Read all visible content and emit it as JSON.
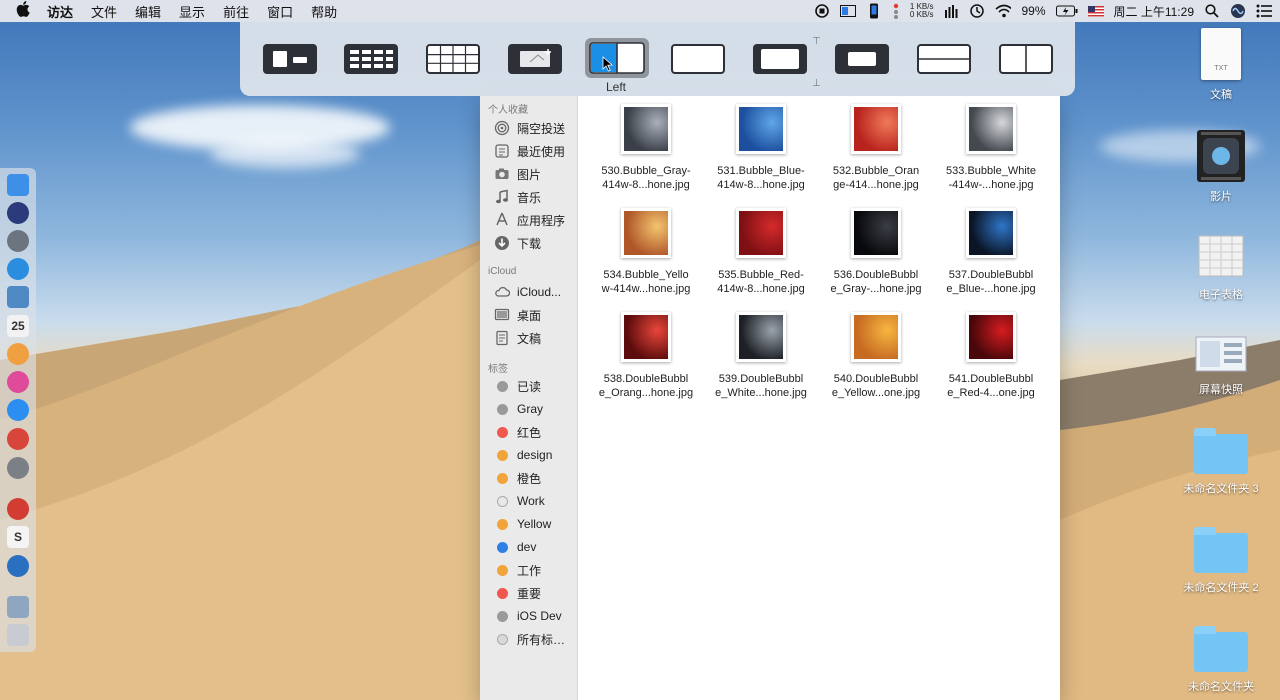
{
  "menubar": {
    "apple_icon": "apple-logo-icon",
    "items": [
      "访达",
      "文件",
      "编辑",
      "显示",
      "前往",
      "窗口",
      "帮助"
    ],
    "net_up": "1 KB/s",
    "net_down": "0 KB/s",
    "battery": "99%",
    "clock": "周二 上午11:29"
  },
  "layout_panel": {
    "selected_label": "Left",
    "options": [
      "fullscreen-plus",
      "grid-2x4",
      "grid-3x4",
      "centered-plus",
      "left-half",
      "wide-center",
      "center",
      "small-center",
      "top-bottom",
      "two-columns"
    ]
  },
  "finder": {
    "sections": {
      "favorites": "个人收藏",
      "icloud": "iCloud",
      "tags": "标签"
    },
    "favorites": [
      {
        "label": "隔空投送",
        "icon": "airdrop-icon"
      },
      {
        "label": "最近使用",
        "icon": "recents-icon"
      },
      {
        "label": "图片",
        "icon": "camera-icon"
      },
      {
        "label": "音乐",
        "icon": "music-icon"
      },
      {
        "label": "应用程序",
        "icon": "applications-icon"
      },
      {
        "label": "下载",
        "icon": "download-icon"
      }
    ],
    "icloud": [
      {
        "label": "iCloud...",
        "icon": "cloud-icon"
      },
      {
        "label": "桌面",
        "icon": "desktop-icon"
      },
      {
        "label": "文稿",
        "icon": "documents-icon"
      }
    ],
    "tags": [
      {
        "label": "已读",
        "color": "#9a9a9a"
      },
      {
        "label": "Gray",
        "color": "#9a9a9a"
      },
      {
        "label": "红色",
        "color": "#f0574d"
      },
      {
        "label": "design",
        "color": "#f2a33a"
      },
      {
        "label": "橙色",
        "color": "#f2a33a"
      },
      {
        "label": "Work",
        "color": "#e8e8e8"
      },
      {
        "label": "Yellow",
        "color": "#f2a33a"
      },
      {
        "label": "dev",
        "color": "#2f7fe6"
      },
      {
        "label": "工作",
        "color": "#f2a33a"
      },
      {
        "label": "重要",
        "color": "#f0574d"
      },
      {
        "label": "iOS Dev",
        "color": "#9a9a9a"
      },
      {
        "label": "所有标…",
        "color": "#d9d9d9"
      }
    ],
    "files": [
      {
        "line1": "530.Bubble_Gray-",
        "line2": "414w-8...hone.jpg",
        "c1": "#3a3f48",
        "c2": "#a9b0ba"
      },
      {
        "line1": "531.Bubble_Blue-",
        "line2": "414w-8...hone.jpg",
        "c1": "#1c4f9e",
        "c2": "#5fa6e8"
      },
      {
        "line1": "532.Bubble_Oran",
        "line2": "ge-414...hone.jpg",
        "c1": "#b8231d",
        "c2": "#f07a5a"
      },
      {
        "line1": "533.Bubble_White",
        "line2": "-414w-...hone.jpg",
        "c1": "#44484f",
        "c2": "#d6d8dc"
      },
      {
        "line1": "534.Bubble_Yello",
        "line2": "w-414w...hone.jpg",
        "c1": "#b0572a",
        "c2": "#f3c46e"
      },
      {
        "line1": "535.Bubble_Red-",
        "line2": "414w-8...hone.jpg",
        "c1": "#7e1014",
        "c2": "#d52a2a"
      },
      {
        "line1": "536.DoubleBubbl",
        "line2": "e_Gray-...hone.jpg",
        "c1": "#08090c",
        "c2": "#3a3d44"
      },
      {
        "line1": "537.DoubleBubbl",
        "line2": "e_Blue-...hone.jpg",
        "c1": "#0b1526",
        "c2": "#2f75c8"
      },
      {
        "line1": "538.DoubleBubbl",
        "line2": "e_Orang...hone.jpg",
        "c1": "#5c0c0c",
        "c2": "#e8463a"
      },
      {
        "line1": "539.DoubleBubbl",
        "line2": "e_White...hone.jpg",
        "c1": "#1d2026",
        "c2": "#9aa3ad"
      },
      {
        "line1": "540.DoubleBubbl",
        "line2": "e_Yellow...one.jpg",
        "c1": "#c76a22",
        "c2": "#f6b640"
      },
      {
        "line1": "541.DoubleBubbl",
        "line2": "e_Red-4...one.jpg",
        "c1": "#4a070a",
        "c2": "#d61c20"
      }
    ]
  },
  "desktop": [
    {
      "label": "文稿",
      "kind": "doc",
      "doc_text": "TXT"
    },
    {
      "label": "影片",
      "kind": "movie"
    },
    {
      "label": "电子表格",
      "kind": "sheet"
    },
    {
      "label": "屏幕快照",
      "kind": "screenshot"
    },
    {
      "label": "未命名文件夹 3",
      "kind": "folder"
    },
    {
      "label": "未命名文件夹 2",
      "kind": "folder"
    },
    {
      "label": "未命名文件夹",
      "kind": "folder"
    }
  ],
  "dock": [
    {
      "name": "finder-icon",
      "color": "#3d8fe8"
    },
    {
      "name": "siri-icon",
      "color": "#2a3a7a"
    },
    {
      "name": "launchpad-icon",
      "color": "#6c7480"
    },
    {
      "name": "safari-icon",
      "color": "#2a8de0"
    },
    {
      "name": "preview-icon",
      "color": "#4f8ac4"
    },
    {
      "name": "calendar-icon",
      "color": "#f2f2f2",
      "text": "25"
    },
    {
      "name": "photos-icon",
      "color": "#f0a040"
    },
    {
      "name": "itunes-icon",
      "color": "#e04a9a"
    },
    {
      "name": "app-store-icon",
      "color": "#2c8ef0"
    },
    {
      "name": "chrome-icon",
      "color": "#d8453a"
    },
    {
      "name": "system-preferences-icon",
      "color": "#7b7f86"
    },
    {
      "name": "paw-icon",
      "color": "#d23c32"
    },
    {
      "name": "slack-icon",
      "color": "#f4f4f4",
      "text": "S"
    },
    {
      "name": "tweetbot-icon",
      "color": "#2a6fc0"
    },
    {
      "name": "downloads-stack-icon",
      "color": "#8ea6c0"
    },
    {
      "name": "trash-icon",
      "color": "#c8ccd2"
    }
  ]
}
